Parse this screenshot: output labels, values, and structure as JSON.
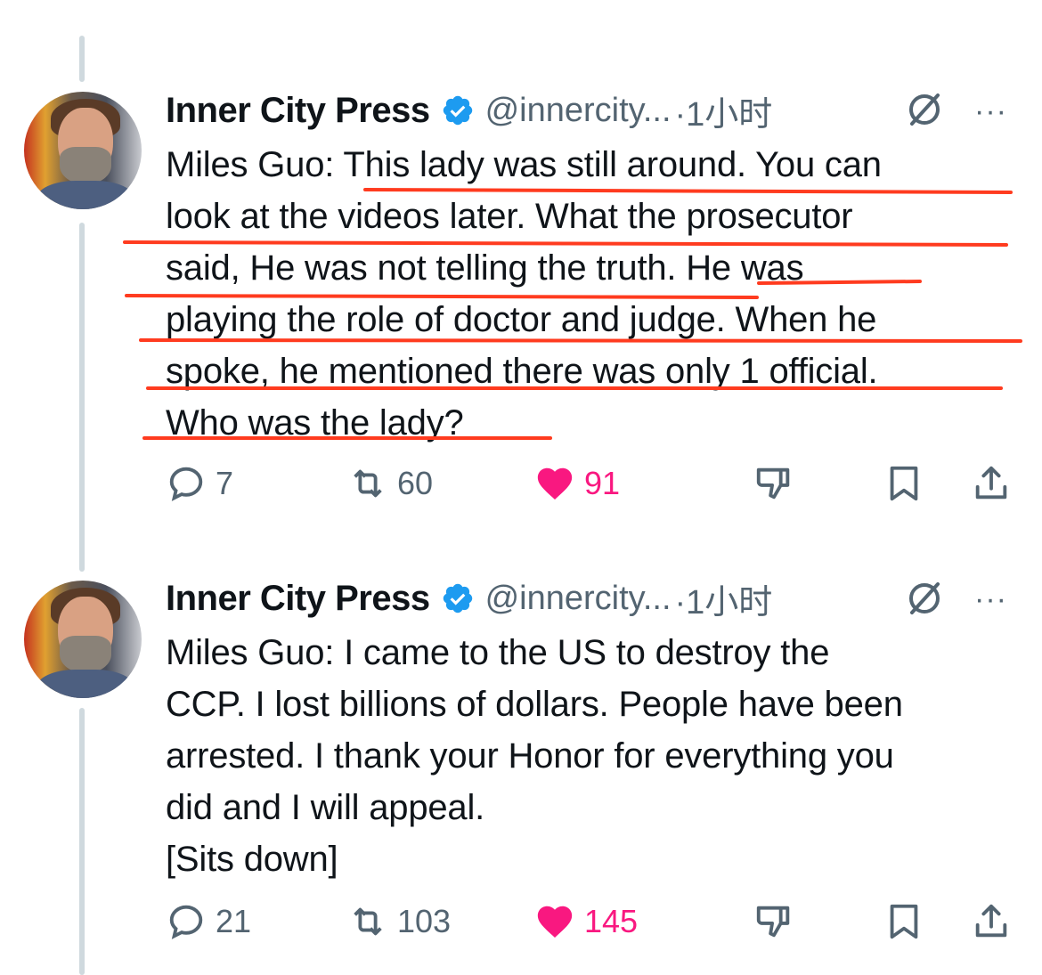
{
  "tweets": [
    {
      "author": "Inner City Press",
      "handle": "@innercity...",
      "time": "·1小时",
      "more": "···",
      "lines": [
        "Miles Guo: This lady was still around. You can",
        "look at the videos later. What the prosecutor",
        "said, He was not telling the truth. He was",
        "playing the role of doctor and judge. When he",
        "spoke, he mentioned there was only 1 official.",
        "Who was the lady?"
      ],
      "replies": "7",
      "reposts": "60",
      "likes": "91"
    },
    {
      "author": "Inner City Press",
      "handle": "@innercity...",
      "time": "·1小时",
      "more": "···",
      "lines": [
        "Miles Guo: I came to the US to destroy the",
        "CCP. I lost billions of dollars. People have been",
        "arrested. I thank your Honor for everything you",
        "did and I will appeal.",
        "[Sits down]"
      ],
      "replies": "21",
      "reposts": "103",
      "likes": "145"
    }
  ],
  "icons": {
    "verified": "verified-badge-icon",
    "grok": "grok-icon",
    "reply": "reply-icon",
    "repost": "repost-icon",
    "like": "heart-icon",
    "dislike": "thumbs-down-icon",
    "bookmark": "bookmark-icon",
    "share": "share-icon"
  },
  "colors": {
    "verified": "#1d9bf0",
    "like": "#f91880",
    "annotation_underline": "#ff3b1f",
    "secondary_text": "#536471",
    "thread_line": "#cfd9de"
  }
}
